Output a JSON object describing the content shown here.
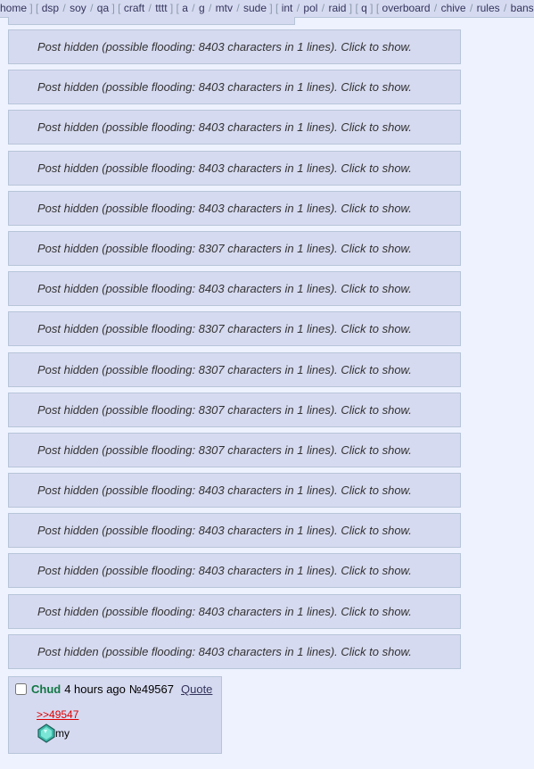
{
  "topnav": {
    "groups": [
      [
        "home"
      ],
      [
        "dsp",
        "soy",
        "qa"
      ],
      [
        "craft",
        "tttt"
      ],
      [
        "a",
        "g",
        "mtv",
        "sude"
      ],
      [
        "int",
        "pol",
        "raid"
      ],
      [
        "q"
      ],
      [
        "overboard",
        "chive",
        "rules",
        "bans"
      ]
    ]
  },
  "hidden_posts": [
    "Post hidden (possible flooding: 8403 characters in 1 lines). Click to show.",
    "Post hidden (possible flooding: 8403 characters in 1 lines). Click to show.",
    "Post hidden (possible flooding: 8403 characters in 1 lines). Click to show.",
    "Post hidden (possible flooding: 8403 characters in 1 lines). Click to show.",
    "Post hidden (possible flooding: 8403 characters in 1 lines). Click to show.",
    "Post hidden (possible flooding: 8307 characters in 1 lines). Click to show.",
    "Post hidden (possible flooding: 8403 characters in 1 lines). Click to show.",
    "Post hidden (possible flooding: 8307 characters in 1 lines). Click to show.",
    "Post hidden (possible flooding: 8307 characters in 1 lines). Click to show.",
    "Post hidden (possible flooding: 8307 characters in 1 lines). Click to show.",
    "Post hidden (possible flooding: 8307 characters in 1 lines). Click to show.",
    "Post hidden (possible flooding: 8403 characters in 1 lines). Click to show.",
    "Post hidden (possible flooding: 8403 characters in 1 lines). Click to show.",
    "Post hidden (possible flooding: 8403 characters in 1 lines). Click to show.",
    "Post hidden (possible flooding: 8403 characters in 1 lines). Click to show.",
    "Post hidden (possible flooding: 8403 characters in 1 lines). Click to show."
  ],
  "reply": {
    "name": "Chud",
    "time": "4 hours ago",
    "number": "№49567",
    "quote_label": "Quote",
    "backlink": ">>49547",
    "text": "my",
    "emoji_icon": "diamond-icon"
  }
}
